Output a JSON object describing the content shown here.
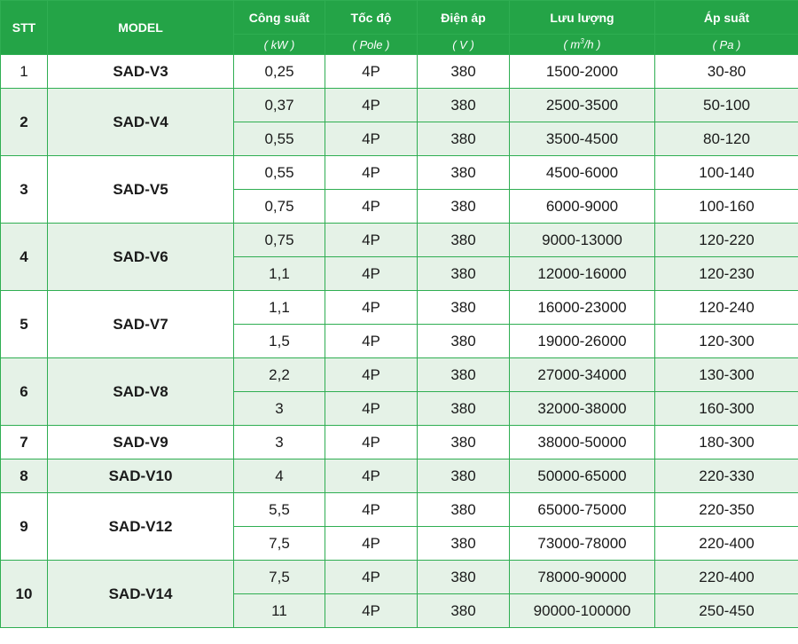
{
  "header": {
    "stt": "STT",
    "model": "MODEL",
    "power": "Công suất",
    "speed": "Tốc độ",
    "voltage": "Điện áp",
    "flow": "Lưu lượng",
    "pressure": "Áp suất",
    "power_unit": "( kW )",
    "speed_unit": "( Pole )",
    "voltage_unit": "( V )",
    "flow_unit_pre": "( m",
    "flow_unit_sup": "3",
    "flow_unit_post": "/h )",
    "pressure_unit": "( Pa )"
  },
  "groups": [
    {
      "stt": "1",
      "model": "SAD-V3",
      "rows": [
        {
          "power": "0,25",
          "speed": "4P",
          "voltage": "380",
          "flow": "1500-2000",
          "pressure": "30-80"
        }
      ]
    },
    {
      "stt": "2",
      "model": "SAD-V4",
      "rows": [
        {
          "power": "0,37",
          "speed": "4P",
          "voltage": "380",
          "flow": "2500-3500",
          "pressure": "50-100"
        },
        {
          "power": "0,55",
          "speed": "4P",
          "voltage": "380",
          "flow": "3500-4500",
          "pressure": "80-120"
        }
      ]
    },
    {
      "stt": "3",
      "model": "SAD-V5",
      "rows": [
        {
          "power": "0,55",
          "speed": "4P",
          "voltage": "380",
          "flow": "4500-6000",
          "pressure": "100-140"
        },
        {
          "power": "0,75",
          "speed": "4P",
          "voltage": "380",
          "flow": "6000-9000",
          "pressure": "100-160"
        }
      ]
    },
    {
      "stt": "4",
      "model": "SAD-V6",
      "rows": [
        {
          "power": "0,75",
          "speed": "4P",
          "voltage": "380",
          "flow": "9000-13000",
          "pressure": "120-220"
        },
        {
          "power": "1,1",
          "speed": "4P",
          "voltage": "380",
          "flow": "12000-16000",
          "pressure": "120-230"
        }
      ]
    },
    {
      "stt": "5",
      "model": "SAD-V7",
      "rows": [
        {
          "power": "1,1",
          "speed": "4P",
          "voltage": "380",
          "flow": "16000-23000",
          "pressure": "120-240"
        },
        {
          "power": "1,5",
          "speed": "4P",
          "voltage": "380",
          "flow": "19000-26000",
          "pressure": "120-300"
        }
      ]
    },
    {
      "stt": "6",
      "model": "SAD-V8",
      "rows": [
        {
          "power": "2,2",
          "speed": "4P",
          "voltage": "380",
          "flow": "27000-34000",
          "pressure": "130-300"
        },
        {
          "power": "3",
          "speed": "4P",
          "voltage": "380",
          "flow": "32000-38000",
          "pressure": "160-300"
        }
      ]
    },
    {
      "stt": "7",
      "model": "SAD-V9",
      "rows": [
        {
          "power": "3",
          "speed": "4P",
          "voltage": "380",
          "flow": "38000-50000",
          "pressure": "180-300"
        }
      ]
    },
    {
      "stt": "8",
      "model": "SAD-V10",
      "rows": [
        {
          "power": "4",
          "speed": "4P",
          "voltage": "380",
          "flow": "50000-65000",
          "pressure": "220-330"
        }
      ]
    },
    {
      "stt": "9",
      "model": "SAD-V12",
      "rows": [
        {
          "power": "5,5",
          "speed": "4P",
          "voltage": "380",
          "flow": "65000-75000",
          "pressure": "220-350"
        },
        {
          "power": "7,5",
          "speed": "4P",
          "voltage": "380",
          "flow": "73000-78000",
          "pressure": "220-400"
        }
      ]
    },
    {
      "stt": "10",
      "model": "SAD-V14",
      "rows": [
        {
          "power": "7,5",
          "speed": "4P",
          "voltage": "380",
          "flow": "78000-90000",
          "pressure": "220-400"
        },
        {
          "power": "11",
          "speed": "4P",
          "voltage": "380",
          "flow": "90000-100000",
          "pressure": "250-450"
        }
      ]
    }
  ],
  "colors": {
    "header_bg": "#24a447",
    "row_alt_bg": "#e5f2e7",
    "border": "#2fae52"
  }
}
